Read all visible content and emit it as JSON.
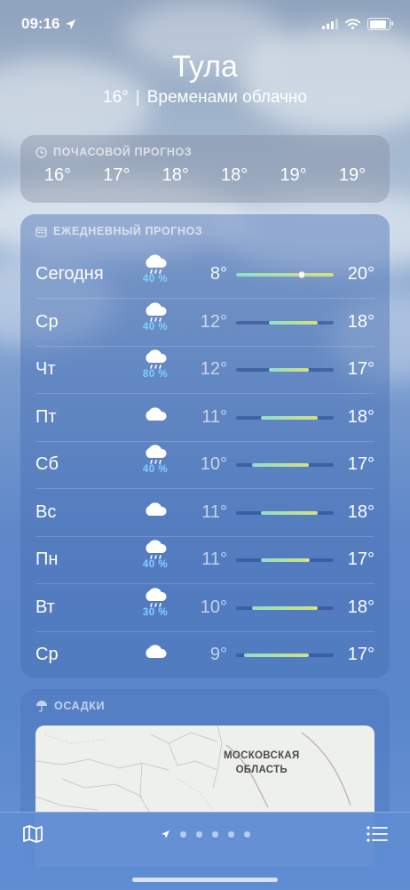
{
  "status": {
    "time": "09:16"
  },
  "city": "Тула",
  "current": {
    "temp": "16°",
    "separator": "|",
    "condition": "Временами облачно"
  },
  "hourly": {
    "title": "ПОЧАСОВОЙ ПРОГНОЗ",
    "temps": [
      "16°",
      "17°",
      "18°",
      "18°",
      "19°",
      "19°"
    ]
  },
  "daily": {
    "title": "ЕЖЕДНЕВНЫЙ ПРОГНОЗ",
    "range_min": 8,
    "range_max": 20,
    "days": [
      {
        "name": "Сегодня",
        "icon": "cloud-rain-icon",
        "precip": "40 %",
        "low": "8°",
        "high": "20°",
        "low_val": 8,
        "high_val": 20,
        "current_val": 16
      },
      {
        "name": "Ср",
        "icon": "cloud-rain-icon",
        "precip": "40 %",
        "low": "12°",
        "high": "18°",
        "low_val": 12,
        "high_val": 18
      },
      {
        "name": "Чт",
        "icon": "cloud-rain-icon",
        "precip": "80 %",
        "low": "12°",
        "high": "17°",
        "low_val": 12,
        "high_val": 17
      },
      {
        "name": "Пт",
        "icon": "cloud-icon",
        "precip": "",
        "low": "11°",
        "high": "18°",
        "low_val": 11,
        "high_val": 18
      },
      {
        "name": "Сб",
        "icon": "cloud-rain-icon",
        "precip": "40 %",
        "low": "10°",
        "high": "17°",
        "low_val": 10,
        "high_val": 17
      },
      {
        "name": "Вс",
        "icon": "cloud-icon",
        "precip": "",
        "low": "11°",
        "high": "18°",
        "low_val": 11,
        "high_val": 18
      },
      {
        "name": "Пн",
        "icon": "cloud-rain-icon",
        "precip": "40 %",
        "low": "11°",
        "high": "17°",
        "low_val": 11,
        "high_val": 17
      },
      {
        "name": "Вт",
        "icon": "cloud-rain-icon",
        "precip": "30 %",
        "low": "10°",
        "high": "18°",
        "low_val": 10,
        "high_val": 18
      },
      {
        "name": "Ср",
        "icon": "cloud-icon",
        "precip": "",
        "low": "9°",
        "high": "17°",
        "low_val": 9,
        "high_val": 17
      }
    ]
  },
  "precipitation": {
    "title": "ОСАДКИ",
    "map_label_line1": "МОСКОВСКАЯ",
    "map_label_line2": "ОБЛАСТЬ"
  },
  "tabbar": {
    "page_count": 5
  },
  "colors": {
    "precip_text": "#7fd0ff",
    "bar_start": "#8fe0cc",
    "bar_end": "#d6e07a"
  }
}
